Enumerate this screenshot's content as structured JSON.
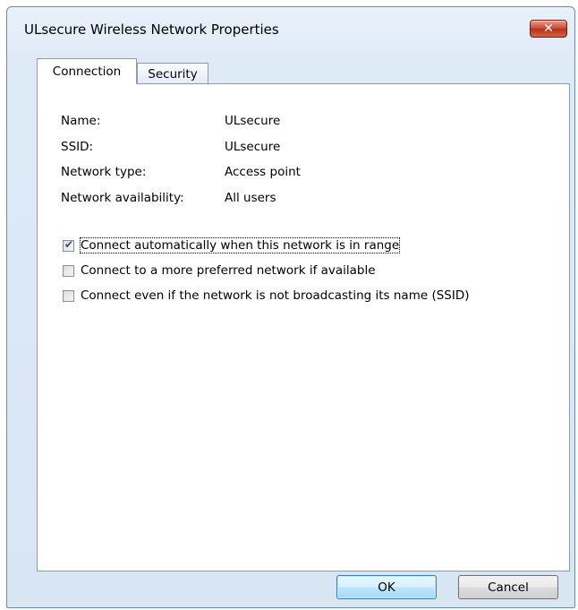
{
  "window": {
    "title": "ULsecure Wireless Network Properties",
    "close_label": "✕"
  },
  "tabs": [
    {
      "label": "Connection",
      "active": true
    },
    {
      "label": "Security",
      "active": false
    }
  ],
  "properties": [
    {
      "label": "Name:",
      "value": "ULsecure"
    },
    {
      "label": "SSID:",
      "value": "ULsecure"
    },
    {
      "label": "Network type:",
      "value": "Access point"
    },
    {
      "label": "Network availability:",
      "value": "All users"
    }
  ],
  "options": [
    {
      "label": "Connect automatically when this network is in range",
      "checked": true
    },
    {
      "label": "Connect to a more preferred network if available",
      "checked": false
    },
    {
      "label": "Connect even if the network is not broadcasting its name (SSID)",
      "checked": false
    }
  ],
  "buttons": {
    "ok": "OK",
    "cancel": "Cancel"
  }
}
